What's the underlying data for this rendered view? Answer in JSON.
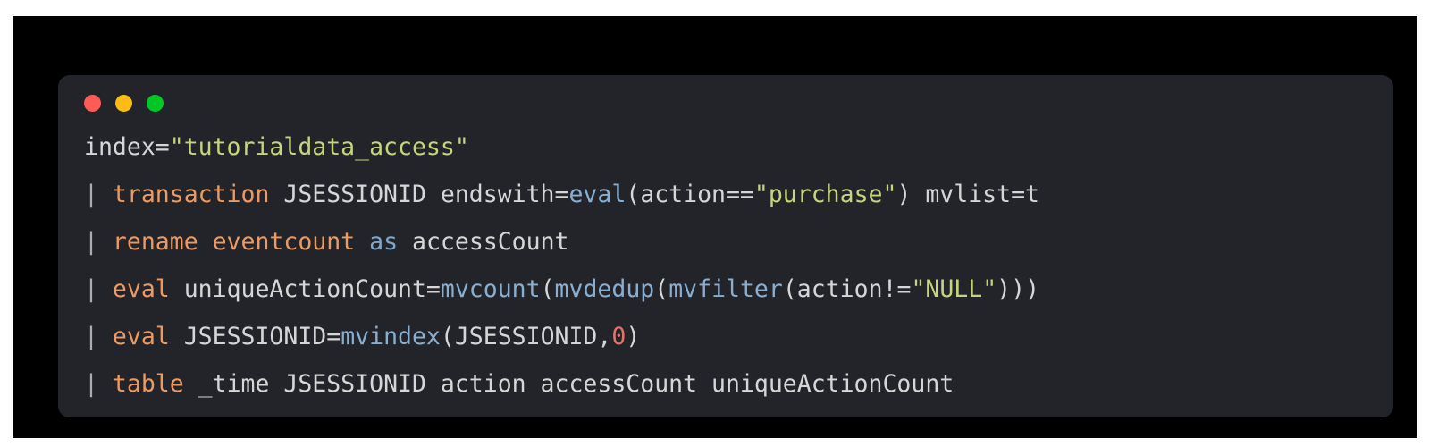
{
  "window": {
    "titlebar": {
      "close_label": "close",
      "minimize_label": "minimize",
      "maximize_label": "maximize"
    },
    "colors": {
      "page_background": "#ffffff",
      "frame_background": "#000000",
      "card_background": "#22242a",
      "dot_close": "#ff5c56",
      "dot_minimize": "#ffbd12",
      "dot_maximize": "#00c726",
      "text_plain": "#d4d6d8",
      "text_pipe": "#a9adb2",
      "text_command": "#eb9a63",
      "text_keyword": "#7fa7cd",
      "text_function": "#89aed0",
      "text_string": "#c7d47e",
      "text_number": "#e2736b"
    }
  },
  "code": {
    "language": "spl",
    "plain_text": "index=\"tutorialdata_access\"\n| transaction JSESSIONID endswith=eval(action==\"purchase\") mvlist=t\n| rename eventcount as accessCount\n| eval uniqueActionCount=mvcount(mvdedup(mvfilter(action!=\"NULL\")))\n| eval JSESSIONID=mvindex(JSESSIONID,0)\n| table _time JSESSIONID action accessCount uniqueActionCount",
    "lines": [
      {
        "id": "line-1",
        "tokens": [
          {
            "t": "index=",
            "c": "plain"
          },
          {
            "t": "\"tutorialdata_access\"",
            "c": "str"
          }
        ]
      },
      {
        "id": "line-2",
        "tokens": [
          {
            "t": "| ",
            "c": "pipe"
          },
          {
            "t": "transaction",
            "c": "cmd"
          },
          {
            "t": " JSESSIONID endswith=",
            "c": "plain"
          },
          {
            "t": "eval",
            "c": "func"
          },
          {
            "t": "(action==",
            "c": "plain"
          },
          {
            "t": "\"purchase\"",
            "c": "str"
          },
          {
            "t": ") mvlist=t",
            "c": "plain"
          }
        ]
      },
      {
        "id": "line-3",
        "tokens": [
          {
            "t": "| ",
            "c": "pipe"
          },
          {
            "t": "rename eventcount",
            "c": "cmd"
          },
          {
            "t": " ",
            "c": "plain"
          },
          {
            "t": "as",
            "c": "kw"
          },
          {
            "t": " accessCount",
            "c": "plain"
          }
        ]
      },
      {
        "id": "line-4",
        "tokens": [
          {
            "t": "| ",
            "c": "pipe"
          },
          {
            "t": "eval",
            "c": "cmd"
          },
          {
            "t": " uniqueActionCount=",
            "c": "plain"
          },
          {
            "t": "mvcount",
            "c": "func"
          },
          {
            "t": "(",
            "c": "plain"
          },
          {
            "t": "mvdedup",
            "c": "func"
          },
          {
            "t": "(",
            "c": "plain"
          },
          {
            "t": "mvfilter",
            "c": "func"
          },
          {
            "t": "(action!=",
            "c": "plain"
          },
          {
            "t": "\"NULL\"",
            "c": "str"
          },
          {
            "t": ")))",
            "c": "plain"
          }
        ]
      },
      {
        "id": "line-5",
        "tokens": [
          {
            "t": "| ",
            "c": "pipe"
          },
          {
            "t": "eval",
            "c": "cmd"
          },
          {
            "t": " JSESSIONID=",
            "c": "plain"
          },
          {
            "t": "mvindex",
            "c": "func"
          },
          {
            "t": "(JSESSIONID,",
            "c": "plain"
          },
          {
            "t": "0",
            "c": "num"
          },
          {
            "t": ")",
            "c": "plain"
          }
        ]
      },
      {
        "id": "line-6",
        "tokens": [
          {
            "t": "| ",
            "c": "pipe"
          },
          {
            "t": "table",
            "c": "cmd"
          },
          {
            "t": " _time JSESSIONID action accessCount uniqueActionCount",
            "c": "plain"
          }
        ]
      }
    ]
  }
}
